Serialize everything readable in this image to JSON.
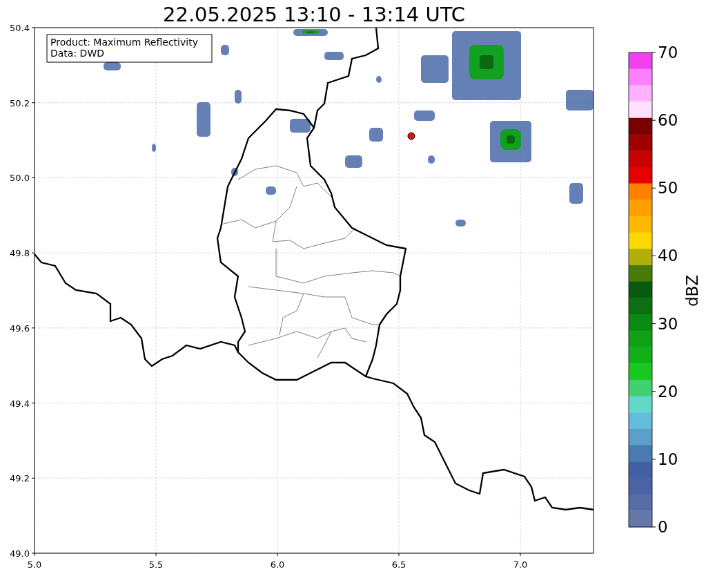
{
  "title": "22.05.2025 13:10 - 13:14 UTC",
  "info_box": {
    "lines": [
      "Product: Maximum Reflectivity",
      "Data: DWD"
    ]
  },
  "map": {
    "xticks": [
      "5.0",
      "5.5",
      "6.0",
      "6.5",
      "7.0"
    ],
    "yticks": [
      "50.4",
      "50.2",
      "50.0",
      "49.8",
      "49.6",
      "49.4",
      "49.2",
      "49.0"
    ]
  },
  "colorbar": {
    "label": "dBZ",
    "ticks": [
      "70",
      "60",
      "50",
      "40",
      "30",
      "20",
      "10",
      "0"
    ],
    "segments": [
      {
        "color": "#f040f0"
      },
      {
        "color": "#ff80ff"
      },
      {
        "color": "#ffb0ff"
      },
      {
        "color": "#ffe0ff"
      },
      {
        "color": "#7a0000"
      },
      {
        "color": "#a00000"
      },
      {
        "color": "#c80000"
      },
      {
        "color": "#e80000"
      },
      {
        "color": "#ff8000"
      },
      {
        "color": "#ffa000"
      },
      {
        "color": "#ffb800"
      },
      {
        "color": "#ffd800"
      },
      {
        "color": "#b0b008"
      },
      {
        "color": "#4a7a08"
      },
      {
        "color": "#085a10"
      },
      {
        "color": "#0a7010"
      },
      {
        "color": "#0a8a10"
      },
      {
        "color": "#10a018"
      },
      {
        "color": "#12b018"
      },
      {
        "color": "#16c820"
      },
      {
        "color": "#40d070"
      },
      {
        "color": "#62d8c8"
      },
      {
        "color": "#62bedc"
      },
      {
        "color": "#5ba0c8"
      },
      {
        "color": "#4a7ab2"
      },
      {
        "color": "#4260a4"
      },
      {
        "color": "#4a62a6"
      },
      {
        "color": "#586ca8"
      },
      {
        "color": "#6577a8"
      }
    ]
  }
}
